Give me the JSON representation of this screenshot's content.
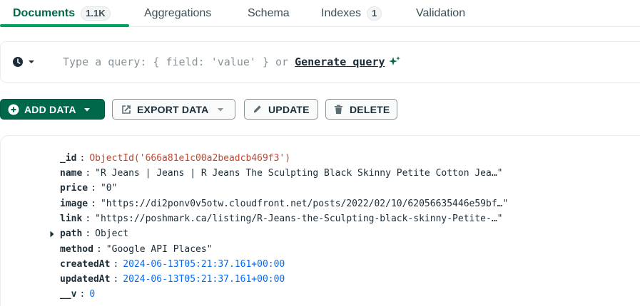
{
  "tabs": [
    {
      "label": "Documents",
      "badge": "1.1K",
      "active": true
    },
    {
      "label": "Aggregations"
    },
    {
      "label": "Schema"
    },
    {
      "label": "Indexes",
      "badge": "1"
    },
    {
      "label": "Validation"
    }
  ],
  "querybar": {
    "placeholder": "Type a query: { field: 'value' } or",
    "generate_label": "Generate query"
  },
  "toolbar": {
    "add_data": "ADD DATA",
    "export_data": "EXPORT DATA",
    "update": "UPDATE",
    "delete": "DELETE"
  },
  "document": {
    "fields": [
      {
        "key": "_id",
        "value": "ObjectId('666a81e1c00a2beadcb469f3')",
        "type": "oid"
      },
      {
        "key": "name",
        "value": "\"R Jeans | Jeans | R Jeans The Sculpting Black Skinny Petite Cotton Jea…\"",
        "type": "str"
      },
      {
        "key": "price",
        "value": "\"0\"",
        "type": "str"
      },
      {
        "key": "image",
        "value": "\"https://di2ponv0v5otw.cloudfront.net/posts/2022/02/10/62056635446e59bf…\"",
        "type": "str"
      },
      {
        "key": "link",
        "value": "\"https://poshmark.ca/listing/R-Jeans-the-Sculpting-black-skinny-Petite-…\"",
        "type": "str"
      },
      {
        "key": "path",
        "value": "Object",
        "type": "obj"
      },
      {
        "key": "method",
        "value": "\"Google API Places\"",
        "type": "str"
      },
      {
        "key": "createdAt",
        "value": "2024-06-13T05:21:37.161+00:00",
        "type": "date"
      },
      {
        "key": "updatedAt",
        "value": "2024-06-13T05:21:37.161+00:00",
        "type": "date"
      },
      {
        "key": "__v",
        "value": "0",
        "type": "num"
      }
    ]
  },
  "colors": {
    "primary": "#00684a",
    "active_underline": "#00a35c",
    "objectid": "#c3452e",
    "date_number": "#016bf8"
  },
  "icons": [
    "clock-icon",
    "chevron-down-icon",
    "sparkle-icon",
    "plus-circle-icon",
    "export-icon",
    "pencil-icon",
    "trash-icon",
    "caret-right-icon"
  ]
}
